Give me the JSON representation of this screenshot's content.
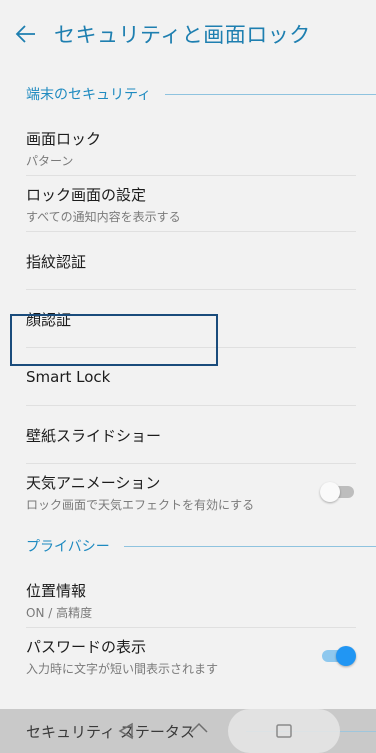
{
  "header": {
    "title": "セキュリティと画面ロック"
  },
  "sections": {
    "device_security": {
      "title": "端末のセキュリティ"
    },
    "privacy": {
      "title": "プライバシー"
    }
  },
  "items": {
    "screen_lock": {
      "title": "画面ロック",
      "subtitle": "パターン"
    },
    "lock_screen_settings": {
      "title": "ロック画面の設定",
      "subtitle": "すべての通知内容を表示する"
    },
    "fingerprint": {
      "title": "指紋認証"
    },
    "face_auth": {
      "title": "顔認証"
    },
    "smart_lock": {
      "title": "Smart Lock"
    },
    "wallpaper_slideshow": {
      "title": "壁紙スライドショー"
    },
    "weather_animation": {
      "title": "天気アニメーション",
      "subtitle": "ロック画面で天気エフェクトを有効にする",
      "toggle": "off"
    },
    "location": {
      "title": "位置情報",
      "subtitle": "ON / 高精度"
    },
    "show_passwords": {
      "title": "パスワードの表示",
      "subtitle": "入力時に文字が短い間表示されます",
      "toggle": "on"
    }
  },
  "peek": {
    "label": "セキュリティ ステータス"
  },
  "colors": {
    "accent": "#1e7fb0",
    "toggle_on": "#2196f3",
    "focus_outline": "#1a4c7c"
  },
  "icons": {
    "back": "arrow-left-icon",
    "nav_back": "triangle-back-icon",
    "nav_home": "home-icon",
    "nav_recents": "recents-icon"
  }
}
